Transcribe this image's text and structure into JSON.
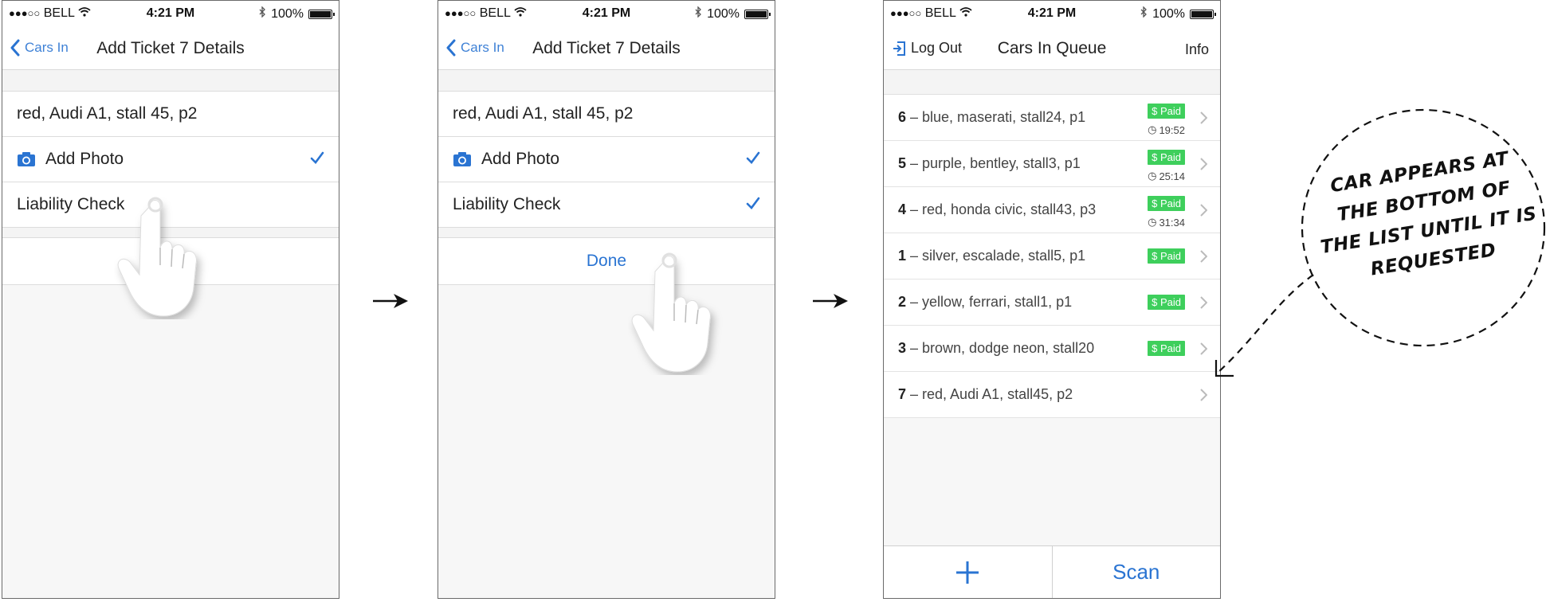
{
  "status": {
    "carrier": "BELL",
    "time": "4:21 PM",
    "battery": "100%"
  },
  "screen1": {
    "back_label": "Cars In",
    "title": "Add Ticket 7 Details",
    "rows": [
      "red, Audi A1, stall 45, p2",
      "Add Photo",
      "Liability Check"
    ]
  },
  "screen2": {
    "back_label": "Cars In",
    "title": "Add Ticket 7 Details",
    "rows": [
      "red, Audi A1, stall 45, p2",
      "Add Photo",
      "Liability Check"
    ],
    "done_label": "Done"
  },
  "screen3": {
    "left_label": "Log Out",
    "title": "Cars In Queue",
    "right_label": "Info",
    "items": [
      {
        "num": "6",
        "desc": "– blue, maserati, stall24, p1",
        "paid": "$ Paid",
        "timer": "19:52"
      },
      {
        "num": "5",
        "desc": "– purple, bentley, stall3, p1",
        "paid": "$ Paid",
        "timer": "25:14"
      },
      {
        "num": "4",
        "desc": "– red, honda civic, stall43, p3",
        "paid": "$ Paid",
        "timer": "31:34"
      },
      {
        "num": "1",
        "desc": "– silver, escalade, stall5, p1",
        "paid": "$ Paid",
        "timer": ""
      },
      {
        "num": "2",
        "desc": "– yellow, ferrari, stall1, p1",
        "paid": "$ Paid",
        "timer": ""
      },
      {
        "num": "3",
        "desc": "– brown, dodge neon, stall20",
        "paid": "$ Paid",
        "timer": ""
      },
      {
        "num": "7",
        "desc": "– red, Audi A1, stall45, p2",
        "paid": "",
        "timer": ""
      }
    ],
    "add_icon": "plus-icon",
    "scan_label": "Scan"
  },
  "callout": {
    "lines": [
      "CAR APPEARS AT",
      "THE BOTTOM OF",
      "THE LIST UNTIL IT IS",
      "REQUESTED"
    ]
  },
  "colors": {
    "accent": "#2a74d2",
    "paid": "#3ecf5c"
  }
}
